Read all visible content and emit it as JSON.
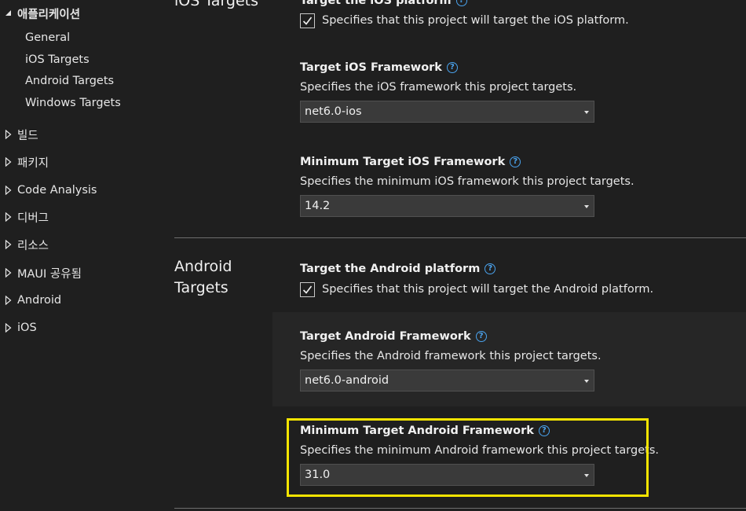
{
  "sidebar": {
    "open_group": {
      "label": "애플리케이션",
      "items": [
        "General",
        "iOS Targets",
        "Android Targets",
        "Windows Targets"
      ]
    },
    "groups": [
      "빌드",
      "패키지",
      "Code Analysis",
      "디버그",
      "리소스",
      "MAUI 공유됨",
      "Android",
      "iOS"
    ]
  },
  "ios_section": {
    "title": "iOS Targets",
    "platform": {
      "title": "Target the iOS platform",
      "checkbox_label": "Specifies that this project will target the iOS platform.",
      "checked": true
    },
    "framework": {
      "title": "Target iOS Framework",
      "description": "Specifies the iOS framework this project targets.",
      "value": "net6.0-ios"
    },
    "min_framework": {
      "title": "Minimum Target iOS Framework",
      "description": "Specifies the minimum iOS framework this project targets.",
      "value": "14.2"
    }
  },
  "android_section": {
    "title_line1": "Android",
    "title_line2": "Targets",
    "platform": {
      "title": "Target the Android platform",
      "checkbox_label": "Specifies that this project will target the Android platform.",
      "checked": true
    },
    "framework": {
      "title": "Target Android Framework",
      "description": "Specifies the Android framework this project targets.",
      "value": "net6.0-android"
    },
    "min_framework": {
      "title": "Minimum Target Android Framework",
      "description": "Specifies the minimum Android framework this project targets.",
      "value": "31.0"
    }
  },
  "icons": {
    "help": "?",
    "check": "checkmark-icon",
    "expand": "triangle-right-icon",
    "expanded": "triangle-down-icon"
  },
  "colors": {
    "background": "#1f1f1f",
    "help": "#4aa3ee",
    "highlight": "#f5e400"
  }
}
